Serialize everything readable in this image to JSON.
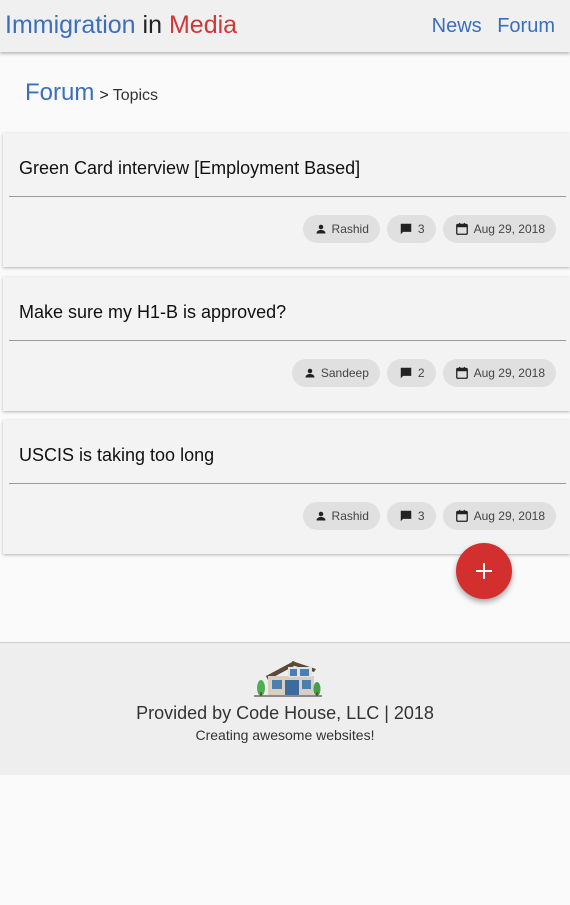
{
  "header": {
    "brand": {
      "part1": "Immigration",
      "part2": "in",
      "part3": "Media"
    },
    "nav": [
      {
        "label": "News"
      },
      {
        "label": "Forum"
      }
    ]
  },
  "breadcrumb": {
    "root": "Forum",
    "separator": ">",
    "current": "Topics"
  },
  "topics": [
    {
      "title": "Green Card interview [Employment Based]",
      "author": "Rashid",
      "replies": "3",
      "date": "Aug 29, 2018"
    },
    {
      "title": "Make sure my H1-B is approved?",
      "author": "Sandeep",
      "replies": "2",
      "date": "Aug 29, 2018"
    },
    {
      "title": "USCIS is taking too long",
      "author": "Rashid",
      "replies": "3",
      "date": "Aug 29, 2018"
    }
  ],
  "fab": {
    "label": "+",
    "icon": "plus-icon"
  },
  "footer": {
    "line1": "Provided by Code House, LLC | 2018",
    "line2": "Creating awesome websites!",
    "logo": "house-logo"
  },
  "colors": {
    "brand_blue": "#3a6fc0",
    "brand_red": "#d0363a",
    "fab_red": "#d32f2f",
    "chip_bg": "#e0e0e0"
  }
}
